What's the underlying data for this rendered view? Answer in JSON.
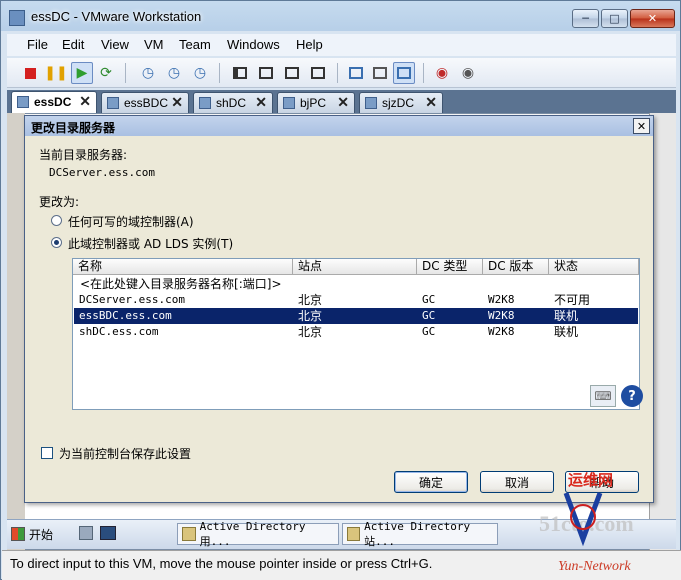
{
  "window": {
    "title": "essDC - VMware Workstation"
  },
  "menu": [
    "File",
    "Edit",
    "View",
    "VM",
    "Team",
    "Windows",
    "Help"
  ],
  "tabs": [
    {
      "label": "essDC",
      "active": true
    },
    {
      "label": "essBDC",
      "active": false
    },
    {
      "label": "shDC",
      "active": false
    },
    {
      "label": "bjPC",
      "active": false
    },
    {
      "label": "sjzDC",
      "active": false
    }
  ],
  "dialog": {
    "title": "更改目录服务器",
    "current_label": "当前目录服务器:",
    "current_value": "DCServer.ess.com",
    "change_to_label": "更改为:",
    "option_any": "任何可写的域控制器(A)",
    "option_this": "此域控制器或 AD LDS 实例(T)",
    "selected_option": "this",
    "columns": [
      "名称",
      "站点",
      "DC 类型",
      "DC 版本",
      "状态"
    ],
    "placeholder_row": "<在此处键入目录服务器名称[:端口]>",
    "rows": [
      {
        "name": "DCServer.ess.com",
        "site": "北京",
        "type": "GC",
        "version": "W2K8",
        "status": "不可用",
        "selected": false
      },
      {
        "name": "essBDC.ess.com",
        "site": "北京",
        "type": "GC",
        "version": "W2K8",
        "status": "联机",
        "selected": true
      },
      {
        "name": "shDC.ess.com",
        "site": "北京",
        "type": "GC",
        "version": "W2K8",
        "status": "联机",
        "selected": false
      }
    ],
    "save_setting_label": "为当前控制台保存此设置",
    "ok_label": "确定",
    "cancel_label": "取消",
    "help_label": "帮助"
  },
  "taskbar": {
    "start_label": "开始",
    "tasks": [
      "Active Directory 用...",
      "Active Directory 站..."
    ]
  },
  "status": {
    "text": "To direct input to this VM, move the mouse pointer inside or press Ctrl+G."
  },
  "watermark": {
    "top": "运维网",
    "mid": "51cto.com",
    "bottom": "Yun-Network"
  },
  "colors": {
    "selection": "#0a246a",
    "dialog_bg": "#ece9d8"
  }
}
